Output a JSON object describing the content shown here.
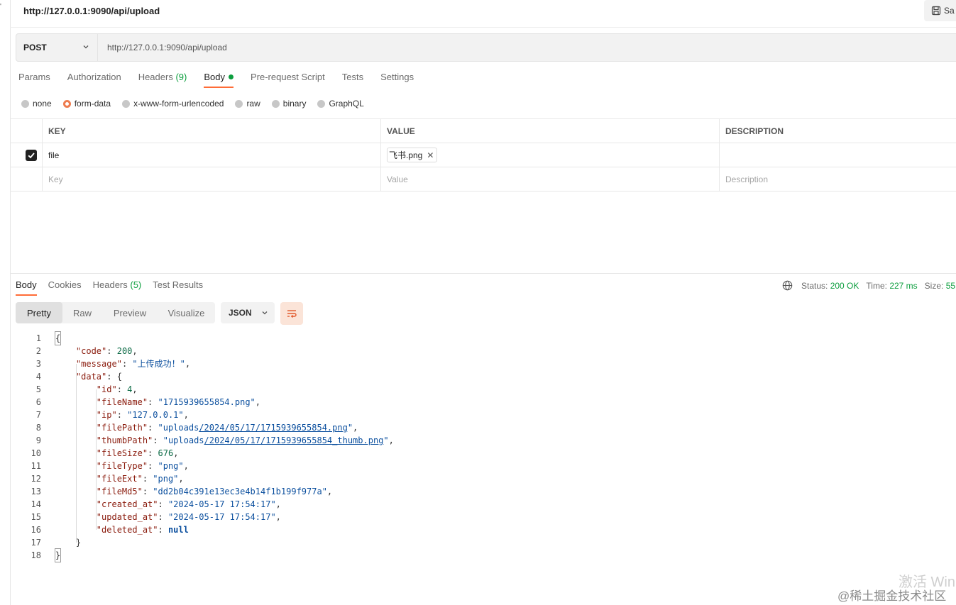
{
  "window": {
    "title": "http://127.0.0.1:9090/api/upload",
    "save_label": "Sa"
  },
  "request": {
    "method": "POST",
    "url": "http://127.0.0.1:9090/api/upload",
    "tabs": [
      {
        "label": "Params"
      },
      {
        "label": "Authorization"
      },
      {
        "label": "Headers",
        "count": "(9)"
      },
      {
        "label": "Body"
      },
      {
        "label": "Pre-request Script"
      },
      {
        "label": "Tests"
      },
      {
        "label": "Settings"
      }
    ],
    "body_types": [
      "none",
      "form-data",
      "x-www-form-urlencoded",
      "raw",
      "binary",
      "GraphQL"
    ],
    "selected_body_type": "form-data"
  },
  "form_table": {
    "headers": {
      "key": "KEY",
      "value": "VALUE",
      "description": "DESCRIPTION"
    },
    "rows": [
      {
        "key": "file",
        "value": "飞书.png",
        "checked": true
      }
    ],
    "placeholders": {
      "key": "Key",
      "value": "Value",
      "description": "Description"
    }
  },
  "response": {
    "tabs": [
      {
        "label": "Body"
      },
      {
        "label": "Cookies"
      },
      {
        "label": "Headers",
        "count": "(5)"
      },
      {
        "label": "Test Results"
      }
    ],
    "status_label": "Status:",
    "status_value": "200 OK",
    "time_label": "Time:",
    "time_value": "227 ms",
    "size_label": "Size:",
    "size_value": "55",
    "views": [
      "Pretty",
      "Raw",
      "Preview",
      "Visualize"
    ],
    "format": "JSON"
  },
  "code_lines": [
    {
      "num": "1",
      "text": "{"
    },
    {
      "num": "2",
      "text": "    \"code\": 200,"
    },
    {
      "num": "3",
      "text": "    \"message\": \"上传成功！\","
    },
    {
      "num": "4",
      "text": "    \"data\": {"
    },
    {
      "num": "5",
      "text": "        \"id\": 4,"
    },
    {
      "num": "6",
      "text": "        \"fileName\": \"1715939655854.png\","
    },
    {
      "num": "7",
      "text": "        \"ip\": \"127.0.0.1\","
    },
    {
      "num": "8",
      "text": "        \"filePath\": \"uploads/2024/05/17/1715939655854.png\","
    },
    {
      "num": "9",
      "text": "        \"thumbPath\": \"uploads/2024/05/17/1715939655854_thumb.png\","
    },
    {
      "num": "10",
      "text": "        \"fileSize\": 676,"
    },
    {
      "num": "11",
      "text": "        \"fileType\": \"png\","
    },
    {
      "num": "12",
      "text": "        \"fileExt\": \"png\","
    },
    {
      "num": "13",
      "text": "        \"fileMd5\": \"dd2b04c391e13ec3e4b14f1b199f977a\","
    },
    {
      "num": "14",
      "text": "        \"created_at\": \"2024-05-17 17:54:17\","
    },
    {
      "num": "15",
      "text": "        \"updated_at\": \"2024-05-17 17:54:17\","
    },
    {
      "num": "16",
      "text": "        \"deleted_at\": null"
    },
    {
      "num": "17",
      "text": "    }"
    },
    {
      "num": "18",
      "text": "}"
    }
  ],
  "watermarks": {
    "activate": "激活 Win",
    "community": "@稀土掘金技术社区"
  },
  "colors": {
    "accent": "#ff6c37",
    "status_green": "#0c9e3e",
    "json_key": "#8a1b0d",
    "json_string": "#0b4f9e"
  }
}
